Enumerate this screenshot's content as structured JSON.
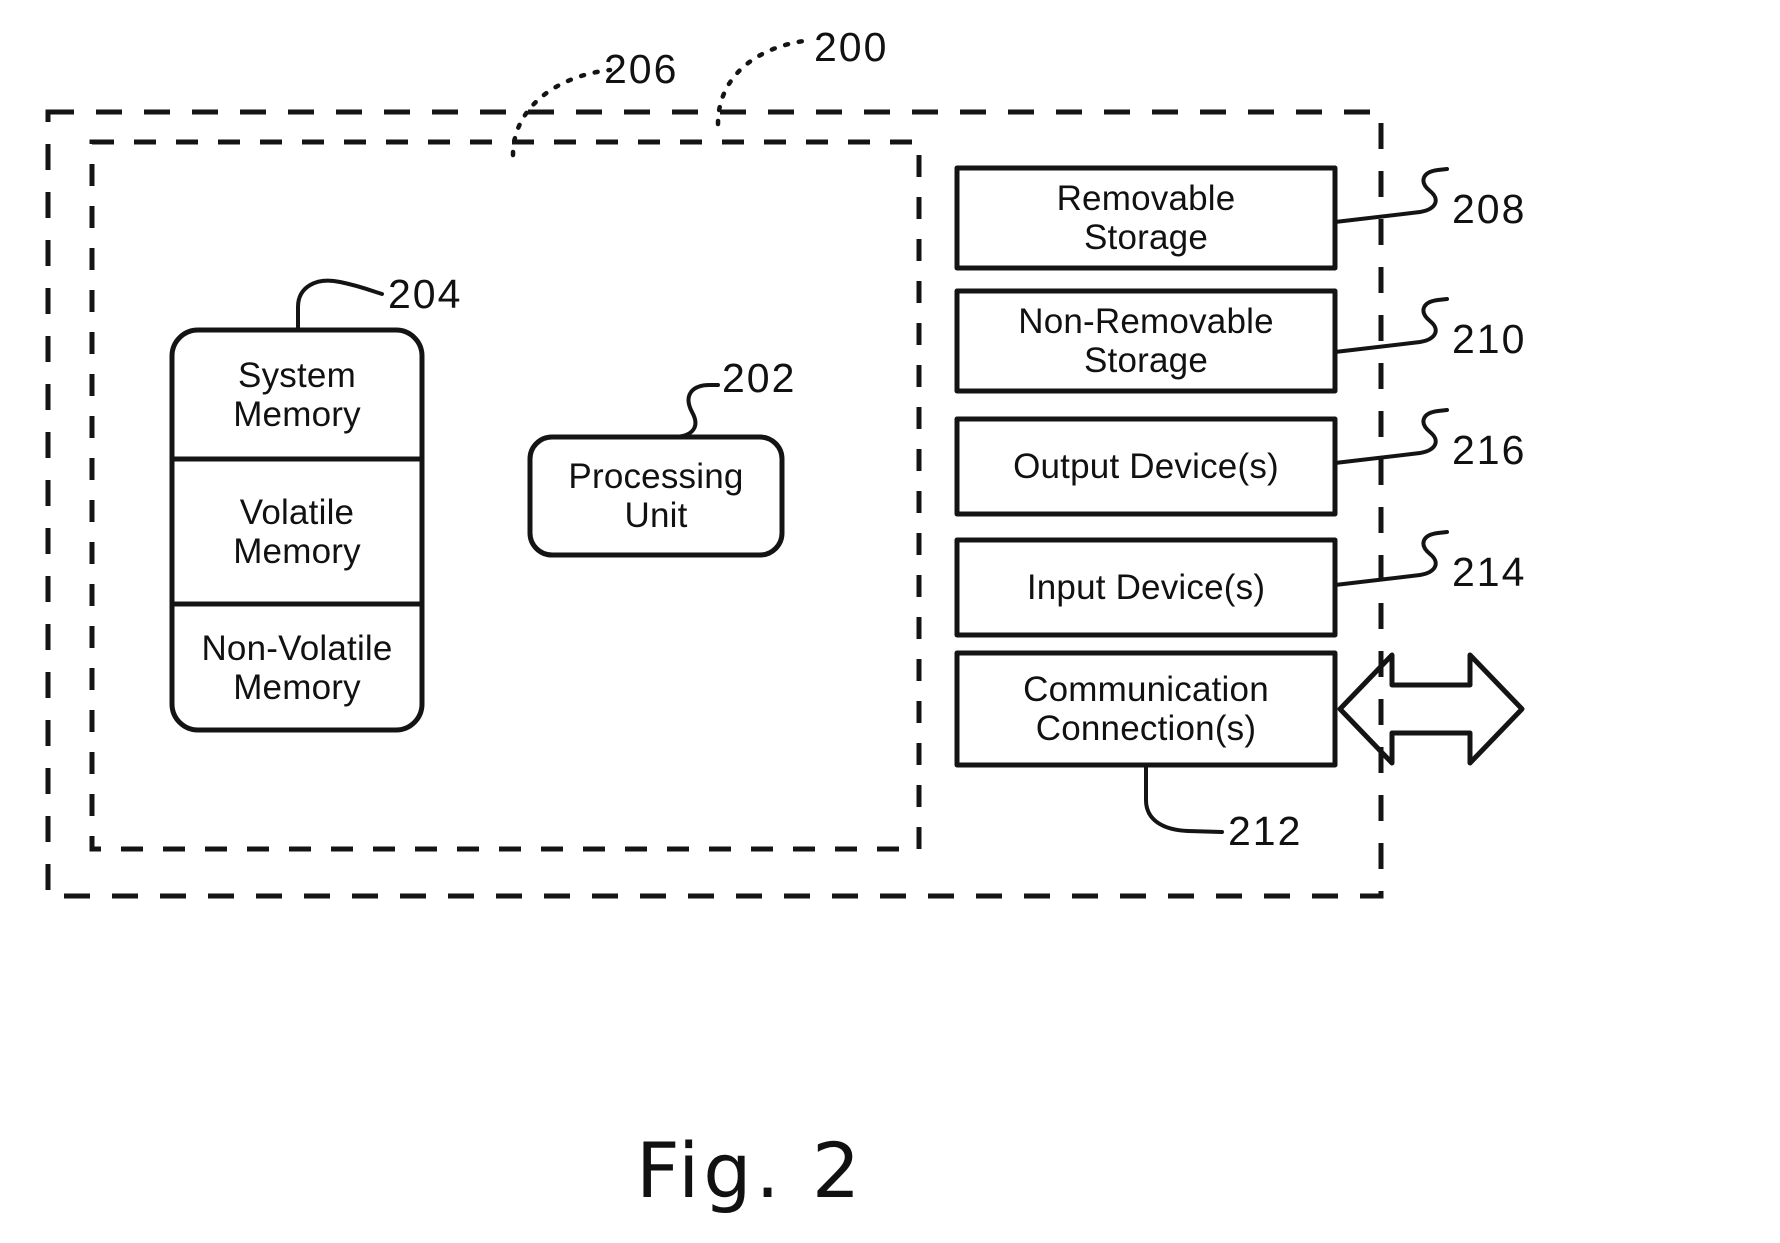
{
  "figure": {
    "caption": "Fig. 2",
    "outer_container_ref": "200",
    "inner_container_ref": "206"
  },
  "blocks": {
    "system_memory": {
      "label": "System\nMemory",
      "ref": "204"
    },
    "volatile_memory": {
      "label": "Volatile\nMemory"
    },
    "non_volatile_memory": {
      "label": "Non-Volatile\nMemory"
    },
    "processing_unit": {
      "label": "Processing\nUnit",
      "ref": "202"
    },
    "removable_storage": {
      "label": "Removable\nStorage",
      "ref": "208"
    },
    "non_removable_storage": {
      "label": "Non-Removable\nStorage",
      "ref": "210"
    },
    "output_devices": {
      "label": "Output Device(s)",
      "ref": "216"
    },
    "input_devices": {
      "label": "Input Device(s)",
      "ref": "214"
    },
    "communication_connections": {
      "label": "Communication\nConnection(s)",
      "ref": "212"
    }
  },
  "colors": {
    "ink": "#111111",
    "background": "#ffffff"
  }
}
